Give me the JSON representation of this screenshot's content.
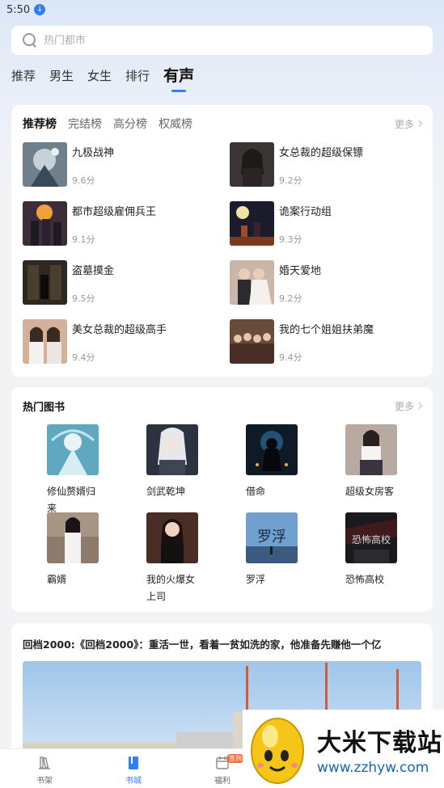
{
  "status_bar": {
    "time": "5:50"
  },
  "search": {
    "placeholder": "热门都市"
  },
  "top_tabs": [
    {
      "label": "推荐",
      "active": false
    },
    {
      "label": "男生",
      "active": false
    },
    {
      "label": "女生",
      "active": false
    },
    {
      "label": "排行",
      "active": false
    },
    {
      "label": "有声",
      "active": true
    }
  ],
  "ranking": {
    "tabs": [
      {
        "label": "推荐榜",
        "active": true
      },
      {
        "label": "完结榜",
        "active": false
      },
      {
        "label": "高分榜",
        "active": false
      },
      {
        "label": "权威榜",
        "active": false
      }
    ],
    "more_label": "更多",
    "items": [
      {
        "title": "九极战神",
        "score": "9.6分"
      },
      {
        "title": "女总裁的超级保镖",
        "score": "9.2分"
      },
      {
        "title": "都市超级雇佣兵王",
        "score": "9.1分"
      },
      {
        "title": "诡案行动组",
        "score": "9.3分"
      },
      {
        "title": "盗墓摸金",
        "score": "9.5分"
      },
      {
        "title": "婚天爱地",
        "score": "9.2分"
      },
      {
        "title": "美女总裁的超级高手",
        "score": "9.4分"
      },
      {
        "title": "我的七个姐姐扶弟魔",
        "score": "9.4分"
      }
    ]
  },
  "hot_books": {
    "title": "热门图书",
    "more_label": "更多",
    "items": [
      {
        "title": "修仙赘婿归来"
      },
      {
        "title": "剑武乾坤"
      },
      {
        "title": "借命"
      },
      {
        "title": "超级女房客"
      },
      {
        "title": "霸婿"
      },
      {
        "title": "我的火爆女上司"
      },
      {
        "title": "罗浮"
      },
      {
        "title": "恐怖高校"
      }
    ],
    "cover_text": {
      "luofu": "罗浮",
      "kongbu": "恐怖高校"
    }
  },
  "article": {
    "title": "回档2000:《回档2000》：重活一世，看着一贫如洗的家，他准备先赚他一个亿"
  },
  "bottom_nav": [
    {
      "label": "书架",
      "active": false
    },
    {
      "label": "书城",
      "active": true
    },
    {
      "label": "福利",
      "active": false,
      "badge": "签到"
    }
  ],
  "watermark": {
    "title": "大米下载站",
    "url": "www.zzhyw.com"
  }
}
